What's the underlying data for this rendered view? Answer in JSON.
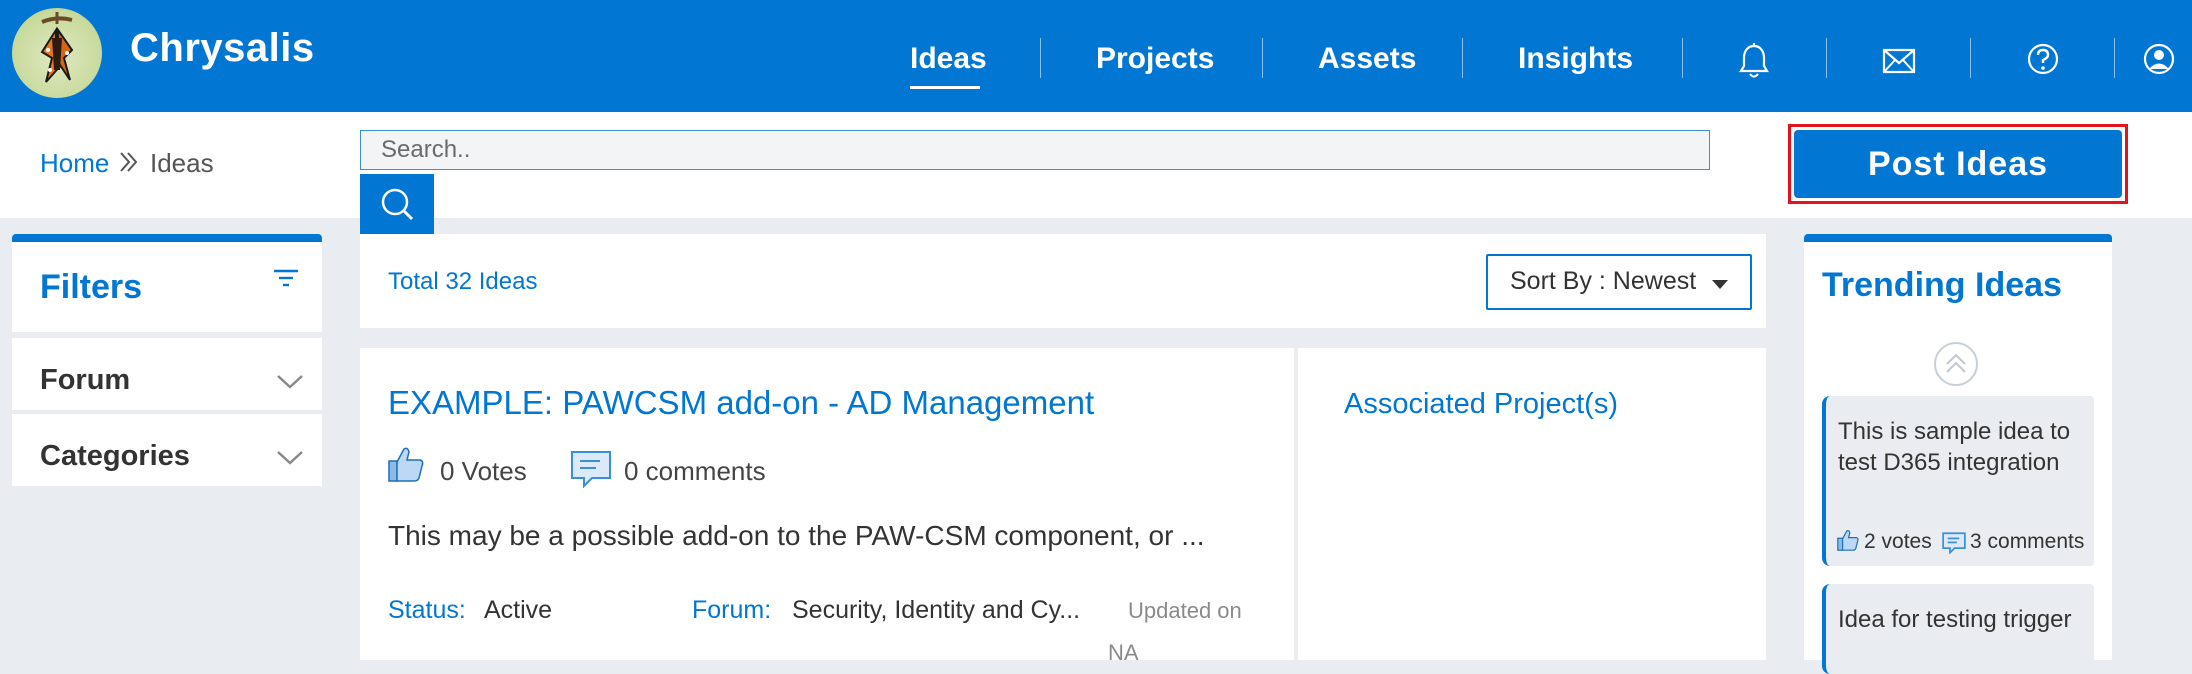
{
  "app": {
    "name": "Chrysalis"
  },
  "nav": {
    "items": [
      {
        "label": "Ideas",
        "active": true
      },
      {
        "label": "Projects"
      },
      {
        "label": "Assets"
      },
      {
        "label": "Insights"
      }
    ],
    "icons": [
      "bell-icon",
      "mail-icon",
      "help-icon",
      "user-icon"
    ]
  },
  "breadcrumb": {
    "home": "Home",
    "current": "Ideas"
  },
  "search": {
    "placeholder": "Search.."
  },
  "post_ideas": {
    "label": "Post Ideas"
  },
  "filters": {
    "title": "Filters",
    "groups": [
      {
        "label": "Forum"
      },
      {
        "label": "Categories"
      }
    ]
  },
  "ideas_list": {
    "total": "Total 32 Ideas",
    "sort_label": "Sort By : Newest"
  },
  "idea": {
    "title": "EXAMPLE: PAWCSM add-on - AD Management",
    "votes": "0 Votes",
    "comments": "0 comments",
    "description": "This may be a possible add-on to the PAW-CSM component, or ...",
    "status_label": "Status:",
    "status_value": "Active",
    "forum_label": "Forum:",
    "forum_value": "Security, Identity and Cy...",
    "updated_label": "Updated on",
    "updated_value": "NA"
  },
  "associated": {
    "title": "Associated Project(s)"
  },
  "trending": {
    "title": "Trending Ideas",
    "items": [
      {
        "text": "This is sample idea to test D365 integration",
        "votes": "2 votes",
        "comments": "3 comments"
      },
      {
        "text": "Idea for testing trigger"
      }
    ]
  },
  "colors": {
    "brand": "#0176d3",
    "highlight": "#e0141e",
    "background": "#e9edf1"
  }
}
